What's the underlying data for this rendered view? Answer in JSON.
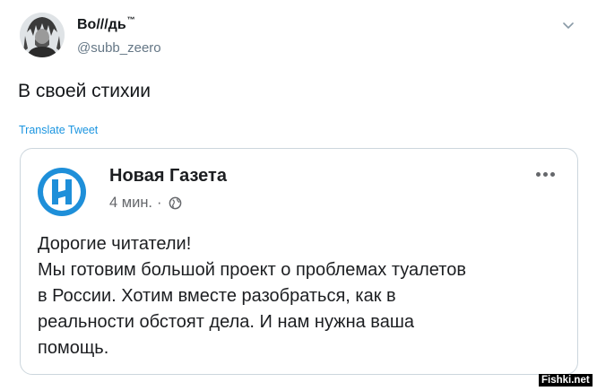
{
  "tweet": {
    "display_name": "Во///дь",
    "trademark": "™",
    "handle": "@subb_zeero",
    "text": "В своей стихии",
    "translate_label": "Translate Tweet"
  },
  "post_card": {
    "author": "Новая Газета",
    "time": "4 мин.",
    "separator": "·",
    "lines": [
      "Дорогие читатели!",
      "Мы готовим большой проект о проблемах туалетов",
      "в России. Хотим вместе разобраться, как в",
      "реальности обстоят дела. И нам нужна ваша",
      "помощь."
    ]
  },
  "watermark": "Fishki.net",
  "colors": {
    "link": "#1b95e0",
    "handle": "#657786",
    "card_border": "#ccd6dd",
    "logo_blue": "#1e8fd9",
    "secondary_text": "#65676b"
  }
}
